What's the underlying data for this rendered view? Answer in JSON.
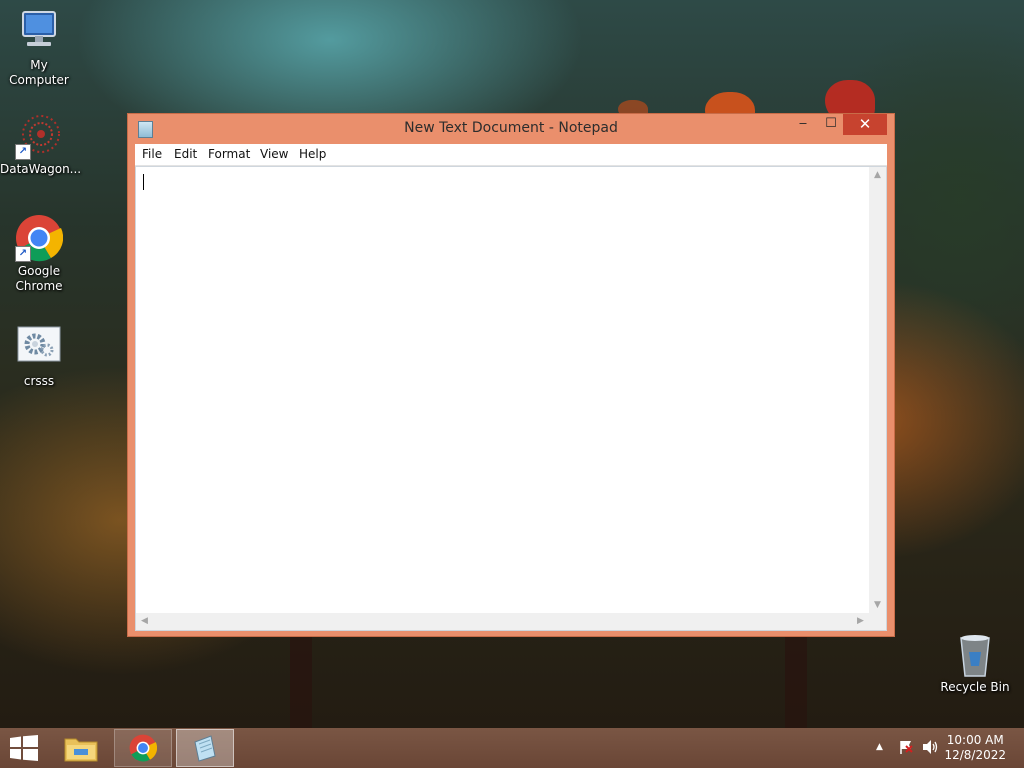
{
  "desktop": {
    "icons": [
      {
        "label": "My Computer",
        "icon": "computer-icon"
      },
      {
        "label": "DataWagon...",
        "icon": "datawagon-icon"
      },
      {
        "label": "Google Chrome",
        "icon": "chrome-icon"
      },
      {
        "label": "crsss",
        "icon": "gear-file-icon"
      },
      {
        "label": "Recycle Bin",
        "icon": "recycle-bin-icon"
      }
    ]
  },
  "window": {
    "title": "New Text Document - Notepad",
    "minimize": "‒",
    "maximize": "☐",
    "close": "✕",
    "menu": [
      "File",
      "Edit",
      "Format",
      "View",
      "Help"
    ],
    "content": "",
    "colors": {
      "frame": "#ea8f6c",
      "close_button": "#c7432f"
    }
  },
  "taskbar": {
    "start_icon": "windows-logo-icon",
    "pinned": [
      "file-explorer-icon",
      "chrome-icon",
      "notepad-icon"
    ],
    "tray": {
      "up_arrow": "▲",
      "flag_icon": "action-center-flag-icon",
      "volume_icon": "speaker-icon"
    },
    "time": "10:00 AM",
    "date": "12/8/2022"
  }
}
